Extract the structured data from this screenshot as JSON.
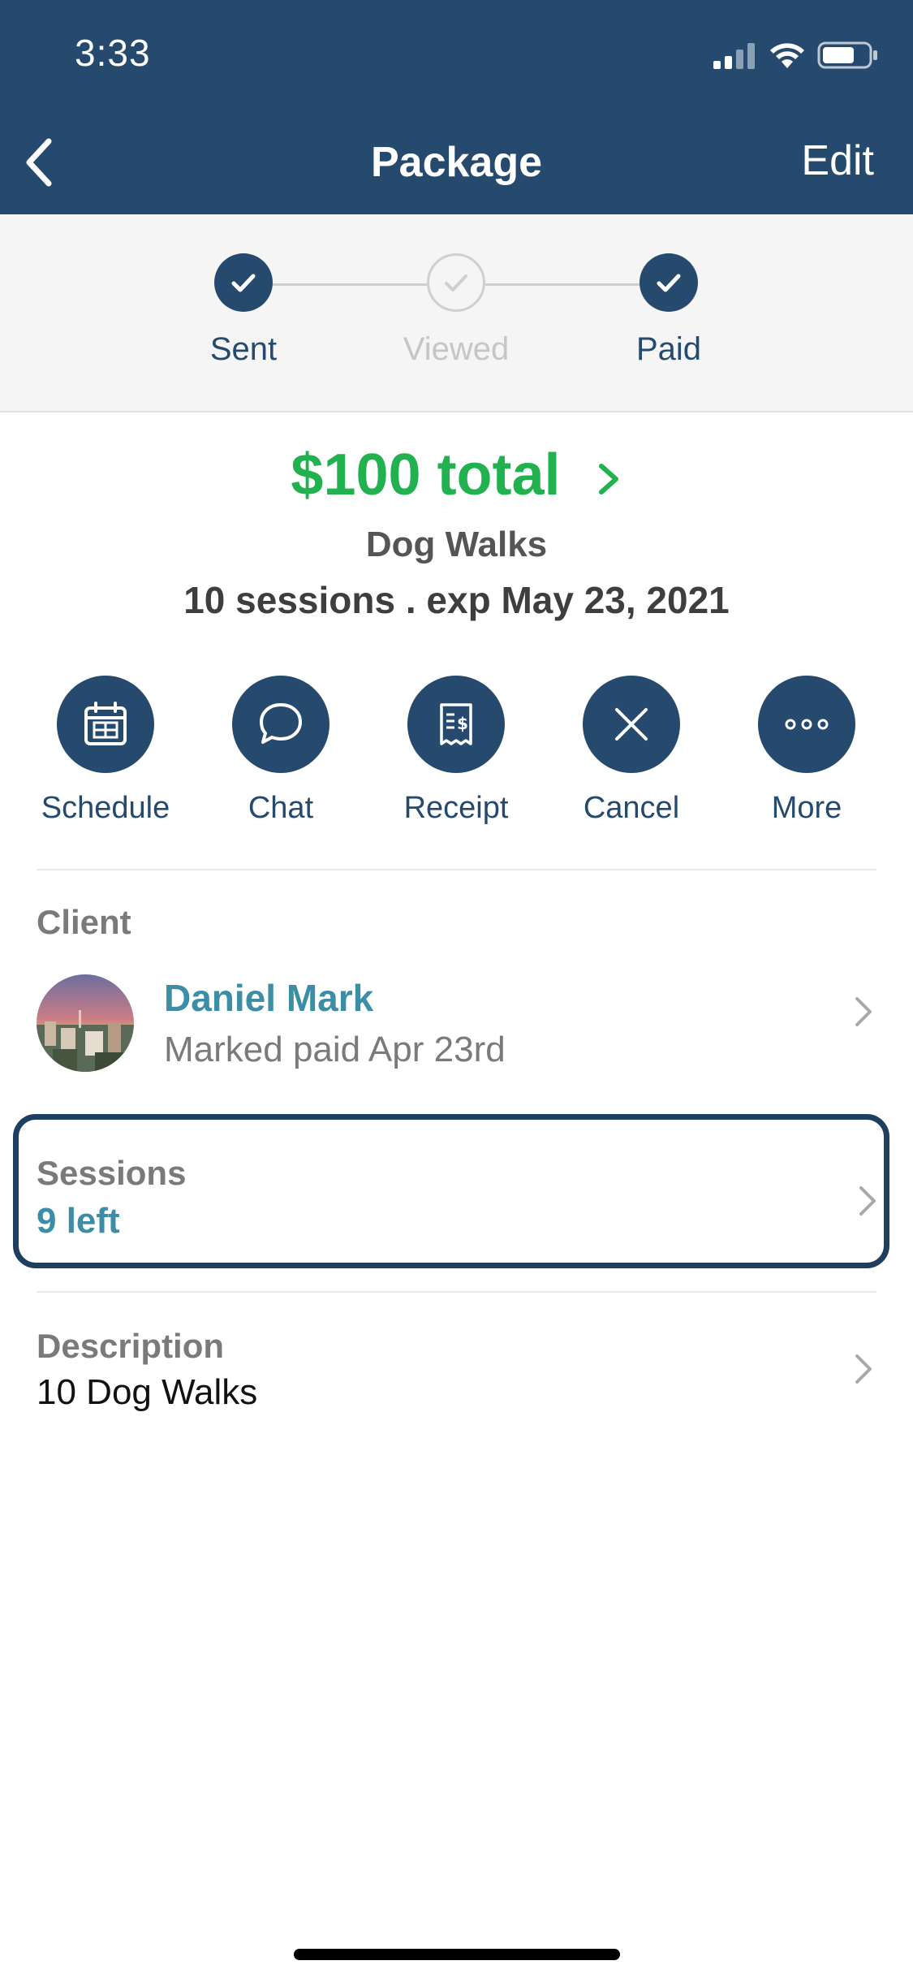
{
  "status_bar": {
    "time": "3:33"
  },
  "nav": {
    "title": "Package",
    "edit_label": "Edit"
  },
  "progress": {
    "steps": [
      {
        "label": "Sent",
        "state": "done"
      },
      {
        "label": "Viewed",
        "state": "pending"
      },
      {
        "label": "Paid",
        "state": "done"
      }
    ]
  },
  "package": {
    "total": "$100 total",
    "name": "Dog Walks",
    "meta": "10 sessions . exp May 23, 2021"
  },
  "actions": [
    {
      "label": "Schedule",
      "icon": "calendar-icon"
    },
    {
      "label": "Chat",
      "icon": "chat-bubble-icon"
    },
    {
      "label": "Receipt",
      "icon": "receipt-icon"
    },
    {
      "label": "Cancel",
      "icon": "close-icon"
    },
    {
      "label": "More",
      "icon": "more-dots-icon"
    }
  ],
  "client": {
    "section_label": "Client",
    "name": "Daniel Mark",
    "status": "Marked paid Apr 23rd"
  },
  "sessions": {
    "label": "Sessions",
    "value": "9 left"
  },
  "description": {
    "label": "Description",
    "value": "10 Dog Walks"
  },
  "colors": {
    "header": "#254A6D",
    "accent_green": "#21B14E",
    "accent_teal": "#3C8DA6"
  }
}
